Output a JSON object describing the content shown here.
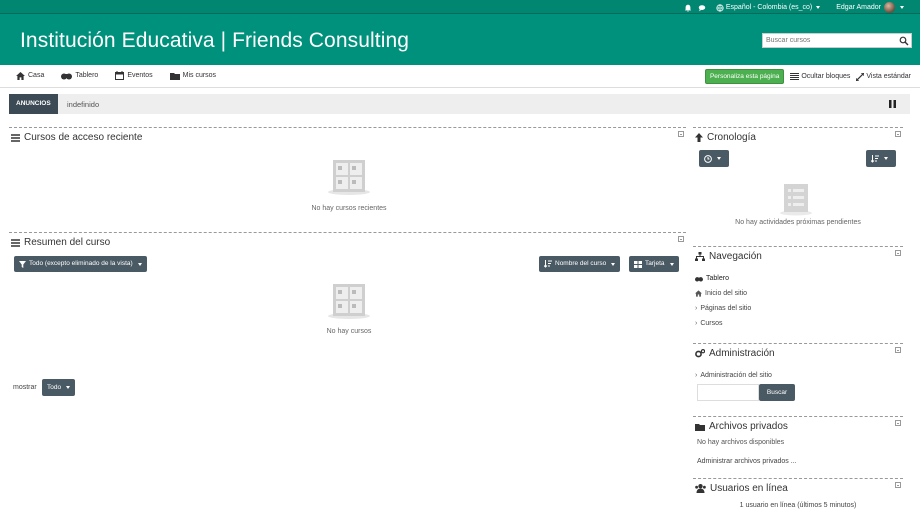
{
  "topbar": {
    "language": "Español - Colombia (es_co)",
    "user_name": "Edgar Amador"
  },
  "header": {
    "site_title": "Institución Educativa | Friends Consulting",
    "search_placeholder": "Buscar cursos"
  },
  "nav": {
    "items": [
      "Casa",
      "Tablero",
      "Eventos",
      "Mis cursos"
    ],
    "customize_button": "Personaliza esta página",
    "hide_blocks": "Ocultar bloques",
    "standard_view": "Vista estándar"
  },
  "announcement": {
    "tag": "ANUNCIOS",
    "text": "indefinido"
  },
  "recent_courses": {
    "title": "Cursos de acceso reciente",
    "empty": "No hay cursos recientes"
  },
  "course_overview": {
    "title": "Resumen del curso",
    "filter_button": "Todo (excepto eliminado de la vista)",
    "sort_button": "Nombre del curso",
    "view_button": "Tarjeta",
    "empty": "No hay cursos",
    "show_label": "mostrar",
    "show_button": "Todo"
  },
  "timeline": {
    "title": "Cronología",
    "empty": "No hay actividades próximas pendientes"
  },
  "navigation": {
    "title": "Navegación",
    "items": [
      "Tablero",
      "Inicio del sitio",
      "Páginas del sitio",
      "Cursos"
    ]
  },
  "administration": {
    "title": "Administración",
    "item": "Administración del sitio",
    "search_button": "Buscar"
  },
  "private_files": {
    "title": "Archivos privados",
    "empty": "No hay archivos disponibles",
    "manage_link": "Administrar archivos privados ..."
  },
  "online_users": {
    "title": "Usuarios en línea",
    "summary": "1 usuario en línea (últimos 5 minutos)"
  },
  "colors": {
    "primary": "#00917c",
    "topbar": "#008671",
    "dark_button": "#4a5a64",
    "green_button": "#4caf50"
  }
}
